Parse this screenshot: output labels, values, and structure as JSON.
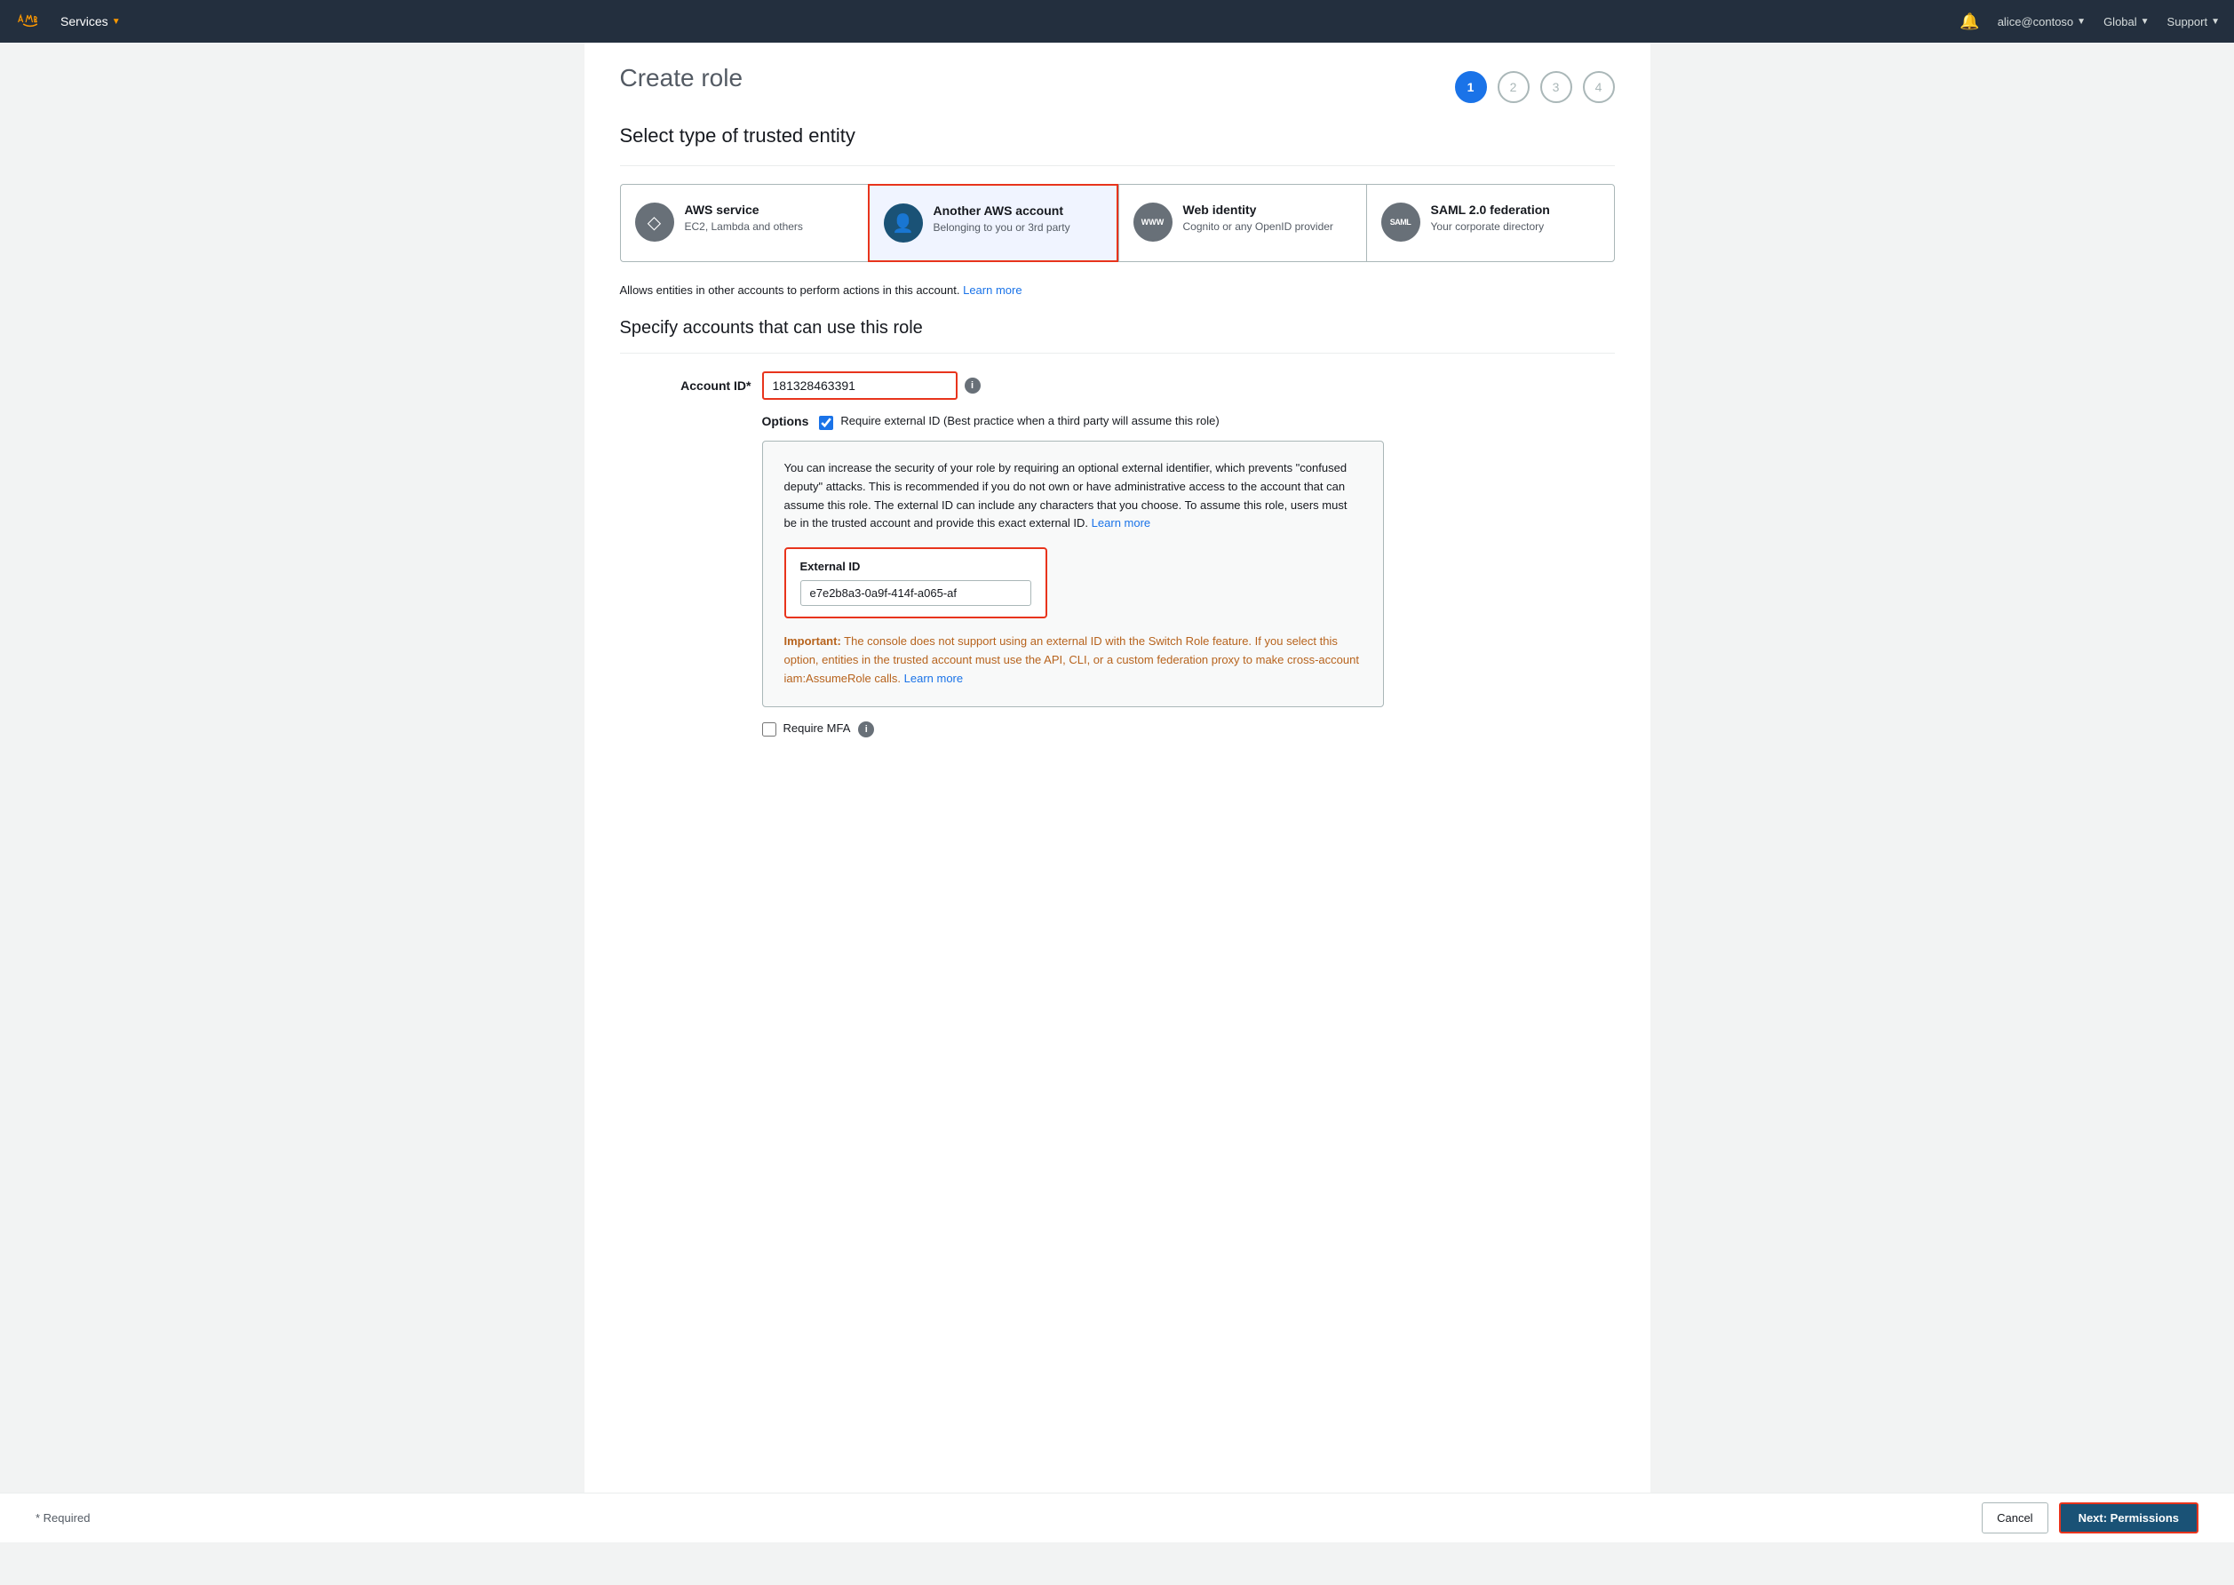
{
  "nav": {
    "logo_alt": "AWS",
    "services_label": "Services",
    "bell_icon": "🔔",
    "user_label": "alice@contoso",
    "region_label": "Global",
    "support_label": "Support"
  },
  "page": {
    "title": "Create role",
    "wizard_steps": [
      "1",
      "2",
      "3",
      "4"
    ]
  },
  "sections": {
    "entity_title": "Select type of trusted entity",
    "entity_cards": [
      {
        "id": "aws-service",
        "title": "AWS service",
        "subtitle": "EC2, Lambda and others",
        "icon_type": "box",
        "selected": false
      },
      {
        "id": "another-aws-account",
        "title": "Another AWS account",
        "subtitle": "Belonging to you or 3rd party",
        "icon_type": "person",
        "selected": true
      },
      {
        "id": "web-identity",
        "title": "Web identity",
        "subtitle": "Cognito or any OpenID provider",
        "icon_type": "www",
        "selected": false
      },
      {
        "id": "saml",
        "title": "SAML 2.0 federation",
        "subtitle": "Your corporate directory",
        "icon_type": "saml",
        "selected": false
      }
    ],
    "entity_info": "Allows entities in other accounts to perform actions in this account.",
    "entity_info_link": "Learn more",
    "accounts_title": "Specify accounts that can use this role",
    "account_id_label": "Account ID*",
    "account_id_value": "181328463391",
    "options_label": "Options",
    "require_external_id_label": "Require external ID (Best practice when a third party will assume this role)",
    "require_external_id_checked": true,
    "external_id_desc": "You can increase the security of your role by requiring an optional external identifier, which prevents \"confused deputy\" attacks. This is recommended if you do not own or have administrative access to the account that can assume this role. The external ID can include any characters that you choose. To assume this role, users must be in the trusted account and provide this exact external ID.",
    "external_id_learn_more": "Learn more",
    "external_id_label": "External ID",
    "external_id_value": "e7e2b8a3-0a9f-414f-a065-af",
    "important_label": "Important:",
    "important_text": "The console does not support using an external ID with the Switch Role feature. If you select this option, entities in the trusted account must use the API, CLI, or a custom federation proxy to make cross-account iam:AssumeRole calls.",
    "important_learn_more": "Learn more",
    "require_mfa_label": "Require MFA",
    "require_mfa_checked": false
  },
  "footer": {
    "required_text": "* Required",
    "cancel_label": "Cancel",
    "next_label": "Next: Permissions"
  }
}
